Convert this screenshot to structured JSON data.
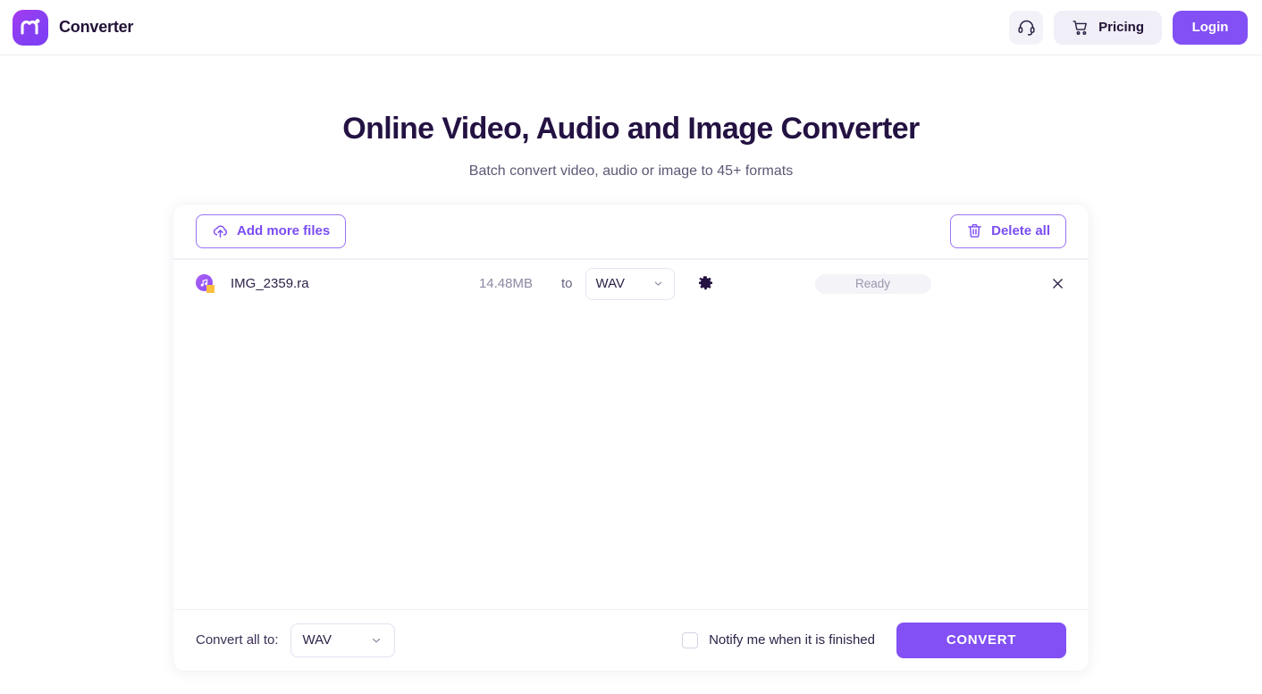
{
  "header": {
    "brand_name": "Converter",
    "logo_letter": "m",
    "support_icon": "headset-icon",
    "pricing": {
      "label": "Pricing",
      "icon": "shopping-cart-icon"
    },
    "login": {
      "label": "Login"
    }
  },
  "hero": {
    "title": "Online Video, Audio and Image Converter",
    "subtitle": "Batch convert video, audio or image to 45+ formats"
  },
  "toolbar": {
    "add_files": {
      "label": "Add more files",
      "icon": "cloud-upload-icon"
    },
    "delete_all": {
      "label": "Delete all",
      "icon": "trash-icon"
    }
  },
  "files": [
    {
      "icon": "audio-file-icon",
      "name": "IMG_2359.ra",
      "size": "14.48MB",
      "to_label": "to",
      "format": "WAV",
      "settings_icon": "gear-icon",
      "status": "Ready",
      "remove_icon": "close-icon"
    }
  ],
  "footer": {
    "convert_all_label": "Convert all to:",
    "convert_all_format": "WAV",
    "notify_label": "Notify me when it is finished",
    "notify_checked": false,
    "convert_button": "CONVERT"
  },
  "colors": {
    "accent": "#8250f4",
    "accent_soft": "#9a74f6",
    "text_dark": "#241243",
    "text_muted": "#8d88a3",
    "chip_bg": "#f4f3f8",
    "header_chip_bg": "#f0eef7",
    "file_badge": "#fbbf3f"
  }
}
